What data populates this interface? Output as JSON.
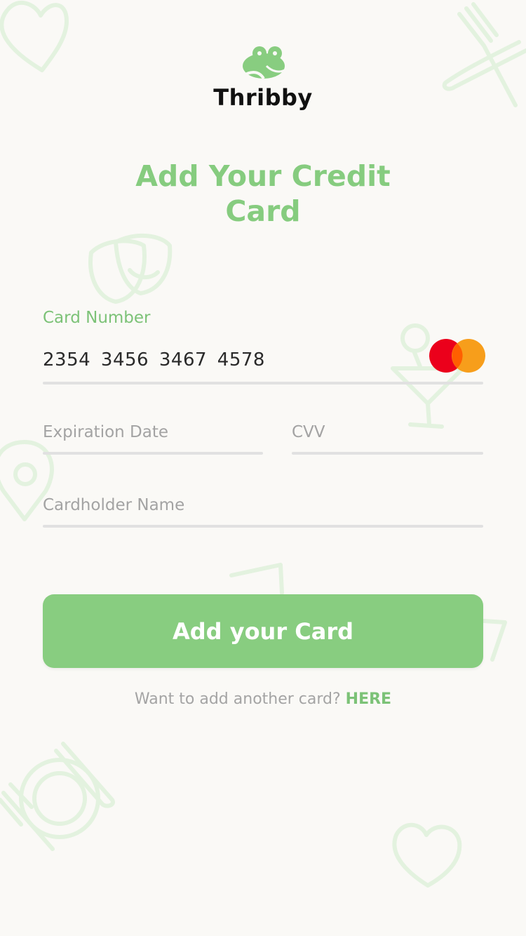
{
  "logo": {
    "name": "Thribby"
  },
  "title": "Add Your Credit\nCard",
  "form": {
    "card_number_label": "Card Number",
    "card_number_value": "2354  3456  3467  4578",
    "card_brand_icon": "mastercard-icon",
    "expiration_placeholder": "Expiration Date",
    "cvv_placeholder": "CVV",
    "cardholder_placeholder": "Cardholder Name"
  },
  "submit_label": "Add your Card",
  "footer": {
    "prompt": "Want to add another card? ",
    "link": "HERE"
  },
  "colors": {
    "accent": "#88cd80",
    "background": "#faf9f6",
    "mastercard_red": "#eb001b",
    "mastercard_orange": "#f79e1b"
  },
  "background_icons": [
    "heart-icon",
    "fork-knife-icon",
    "theater-masks-icon",
    "cocktail-icon",
    "location-pin-icon",
    "drink-glass-icon",
    "plate-cutlery-icon",
    "heart-icon"
  ]
}
